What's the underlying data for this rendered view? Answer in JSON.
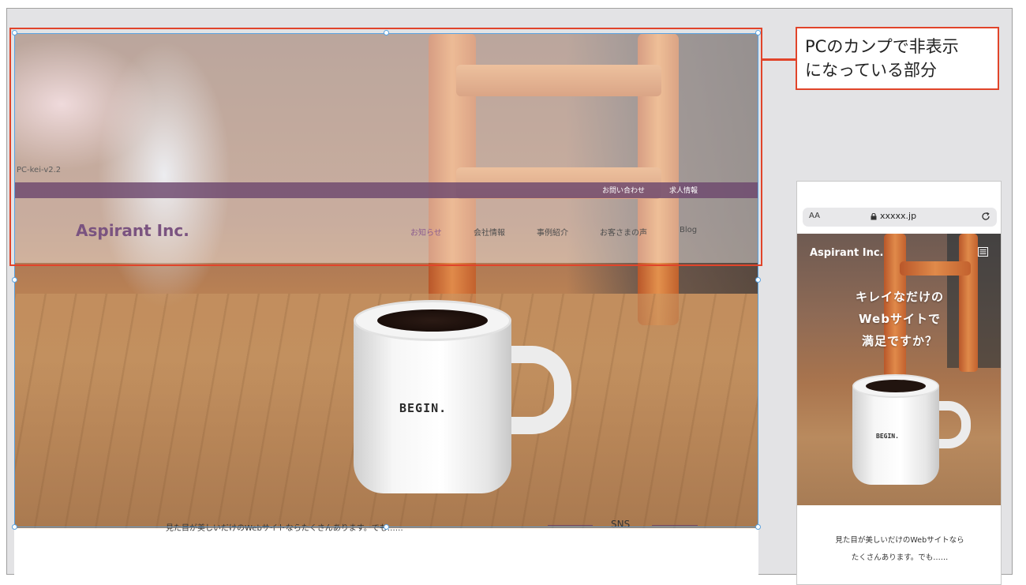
{
  "callout": {
    "line1": "PCのカンプで非表示",
    "line2": "になっている部分"
  },
  "pc": {
    "version": "PC-kei-v2.2",
    "top_links": [
      "お問い合わせ",
      "求人情報"
    ],
    "logo": "Aspirant Inc.",
    "nav": [
      "お知らせ",
      "会社情報",
      "事例紹介",
      "お客さまの声",
      "Blog"
    ],
    "mug_text": "BEGIN.",
    "intro_text": "見た目が美しいだけのWebサイトならたくさんあります。でも……",
    "sns_label": "SNS"
  },
  "phone": {
    "url_aa": "AA",
    "url": "xxxxx.jp",
    "logo": "Aspirant Inc.",
    "catch": [
      "キレイなだけの",
      "Webサイトで",
      "満足ですか？"
    ],
    "mug_text": "BEGIN.",
    "intro": [
      "見た目が美しいだけのWebサイトなら",
      "たくさんあります。でも……"
    ]
  },
  "colors": {
    "accent": "#7a5380",
    "highlight": "#e1442a",
    "selection": "#5aa2e0"
  }
}
